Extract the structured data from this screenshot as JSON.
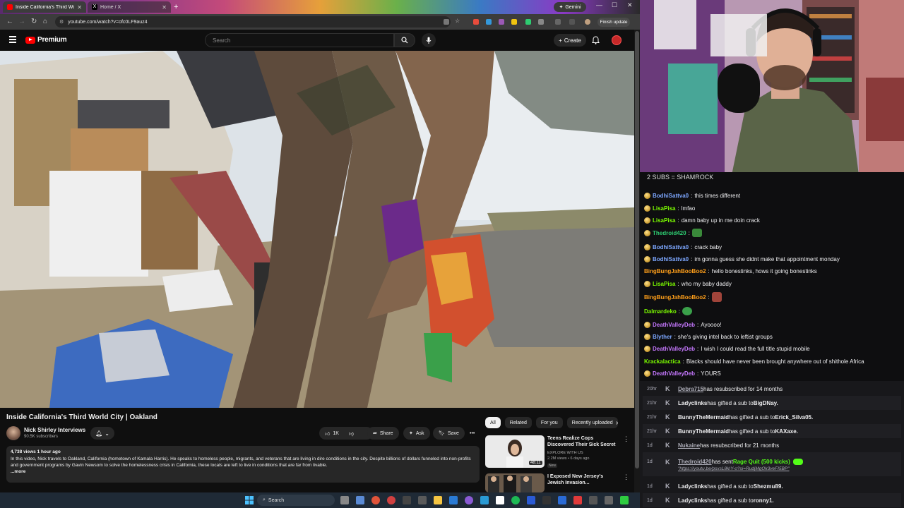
{
  "browser": {
    "tabs": [
      {
        "label": "Inside California's Third World",
        "active": true
      },
      {
        "label": "Home / X",
        "active": false
      }
    ],
    "new_tab": "+",
    "gemini_label": "Gemini",
    "url": "youtube.com/watch?v=ofc0LF9auz4",
    "finish_update": "Finish update"
  },
  "youtube": {
    "logo_text": "Premium",
    "search_placeholder": "Search",
    "create_label": "Create",
    "video": {
      "title": "Inside California's Third World City | Oakland",
      "channel": "Nick Shirley Interviews",
      "subscribers": "90.5K subscribers",
      "likes": "1K",
      "share": "Share",
      "ask": "Ask",
      "save": "Save",
      "description": {
        "meta": "4,738 views  1 hour ago",
        "text": "In this video, Nick travels to Oakland, California (hometown of Kamala Harris). He speaks to homeless people, migrants, and veterans that are living in dire conditions in the city. Despite billions of dollars funneled into non-profits and government programs by Gavin Newsom to solve the homelessness crisis in California, these locals are left to live in conditions that are far from livable.",
        "more": "...more"
      }
    },
    "chips": [
      "All",
      "Related",
      "For you",
      "Recently uploaded"
    ],
    "recommendations": [
      {
        "title": "Teens Realize Cops Discovered Their Sick Secret",
        "channel": "EXPLORE WITH US",
        "meta": "2.2M views • 6 days ago",
        "badge": "New",
        "duration": "48:11"
      },
      {
        "title": "I Exposed New Jersey's Jewish Invasion...",
        "channel": "",
        "meta": "",
        "badge": "",
        "duration": ""
      }
    ]
  },
  "taskbar": {
    "search_label": "Search"
  },
  "stream": {
    "banner": "2 SUBS = SHAMROCK",
    "chat": [
      {
        "user": "BodhiSattva0",
        "color": "#7da7ff",
        "text": "this times different",
        "badge": true
      },
      {
        "user": "LisaPisa",
        "color": "#7cfc00",
        "text": "lmfao",
        "badge": true
      },
      {
        "user": "LisaPisa",
        "color": "#7cfc00",
        "text": "damn baby up in me doin crack",
        "badge": true
      },
      {
        "user": "Thedroid420",
        "color": "#2ecc71",
        "text": "",
        "badge": true,
        "emote": "#3a8a3a"
      },
      {
        "user": "BodhiSattva0",
        "color": "#7da7ff",
        "text": "crack baby",
        "badge": true
      },
      {
        "user": "BodhiSattva0",
        "color": "#7da7ff",
        "text": "im gonna guess she didnt make that appointment monday",
        "badge": true
      },
      {
        "user": "BingBungJahBooBoo2",
        "color": "#ff9f1a",
        "text": "hello bonestinks, hows it going bonestinks",
        "badge": false
      },
      {
        "user": "LisaPisa",
        "color": "#7cfc00",
        "text": "who my baby daddy",
        "badge": true
      },
      {
        "user": "BingBungJahBooBoo2",
        "color": "#ff9f1a",
        "text": "",
        "badge": false,
        "emote": "#a0443a"
      },
      {
        "user": "Dalmardeko",
        "color": "#7cfc00",
        "text": "",
        "badge": false,
        "emote": "#3aa04a"
      },
      {
        "user": "DeathValleyDeb",
        "color": "#c678ff",
        "text": "Ayoooo!",
        "badge": true
      },
      {
        "user": "Blyther",
        "color": "#7da7ff",
        "text": "she's giving intel back to leftist groups",
        "badge": true
      },
      {
        "user": "DeathValleyDeb",
        "color": "#c678ff",
        "text": "I wish I could read the full title stupid mobile",
        "badge": true
      },
      {
        "user": "Krackalactica",
        "color": "#7cfc00",
        "text": "Blacks should have never been brought anywhere out of shithole Africa",
        "badge": false
      },
      {
        "user": "DeathValleyDeb",
        "color": "#c678ff",
        "text": "YOURS",
        "badge": true
      }
    ],
    "events": [
      {
        "time": "20hr",
        "user": "Debra715",
        "text": " has resubscribed for 14 months",
        "underline": true
      },
      {
        "time": "21hr",
        "user": "Ladyclinks",
        "text": " has gifted a sub to ",
        "target": "BigDNay."
      },
      {
        "time": "21hr",
        "user": "BunnyTheMermaid",
        "text": " has gifted a sub to ",
        "target": "Erick_Silva05."
      },
      {
        "time": "21hr",
        "user": "BunnyTheMermaid",
        "text": " has gifted a sub to ",
        "target": "KAXaxe."
      },
      {
        "time": "1d",
        "user": "Nukaine",
        "text": " has resubscribed for 21 months",
        "underline": true
      },
      {
        "time": "1d",
        "user": "Thedroid420",
        "text": " has sent ",
        "target": "Rage Quit (500 kicks)",
        "link": "\"https://youtu.be/psxsL8kIY-o?si=RudjMgOk3veFI5BP\"",
        "underline": true
      },
      {
        "time": "1d",
        "user": "Ladyclinks",
        "text": " has gifted a sub to ",
        "target": "Shezmu89."
      },
      {
        "time": "1d",
        "user": "Ladyclinks",
        "text": " has gifted a sub to ",
        "target": "ronny1."
      }
    ]
  },
  "colors": {
    "youtube_red": "#ff0000",
    "chat_bg": "#0e0e10",
    "events_bg": "#18181b",
    "kick_green": "#53fc18"
  }
}
